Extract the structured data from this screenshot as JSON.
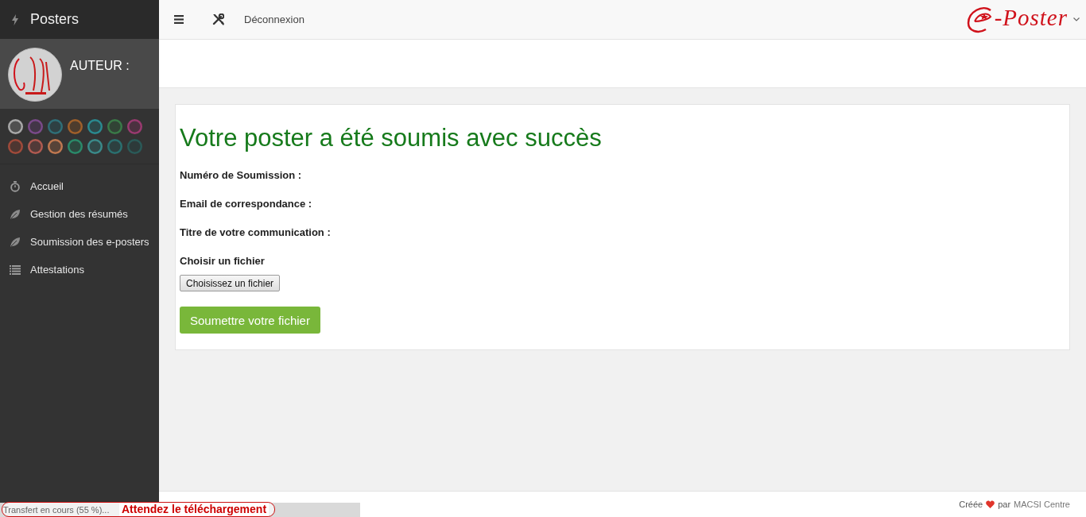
{
  "sidebar": {
    "brand": "Posters",
    "profile": {
      "role": "AUTEUR :"
    },
    "swatches": [
      {
        "color": "#a8a8a8"
      },
      {
        "color": "#7a4a8a"
      },
      {
        "color": "#2f6f78"
      },
      {
        "color": "#a0602a"
      },
      {
        "color": "#2a8a90"
      },
      {
        "color": "#3a7a48"
      },
      {
        "color": "#9a3a70"
      },
      {
        "color": "#a04a3a"
      },
      {
        "color": "#b05a50"
      },
      {
        "color": "#c07850"
      },
      {
        "color": "#2a8a6a"
      },
      {
        "color": "#3a8a8a"
      },
      {
        "color": "#2a7070"
      },
      {
        "color": "#2a5a58"
      }
    ],
    "items": [
      {
        "label": "Accueil",
        "selected": false
      },
      {
        "label": "Gestion des résumés",
        "selected": false
      },
      {
        "label": "Soumission des e-posters",
        "selected": false
      },
      {
        "label": "Attestations",
        "selected": false
      }
    ]
  },
  "header": {
    "logout": "Déconnexion",
    "logo": {
      "text": "-Poster"
    }
  },
  "card": {
    "title": "Votre poster a été soumis avec succès",
    "fields": [
      "Numéro de Soumission :",
      "Email de correspondance :",
      "Titre de votre communication :"
    ],
    "file_label": "Choisir un fichier",
    "file_button": "Choisissez un fichier",
    "submit": "Soumettre votre fichier"
  },
  "footer": {
    "created": "Créée",
    "by": "par",
    "link": "MACSI Centre"
  },
  "upload_status": {
    "progress": "Transfert en cours (55 %)...",
    "message": "Attendez le téléchargement"
  }
}
